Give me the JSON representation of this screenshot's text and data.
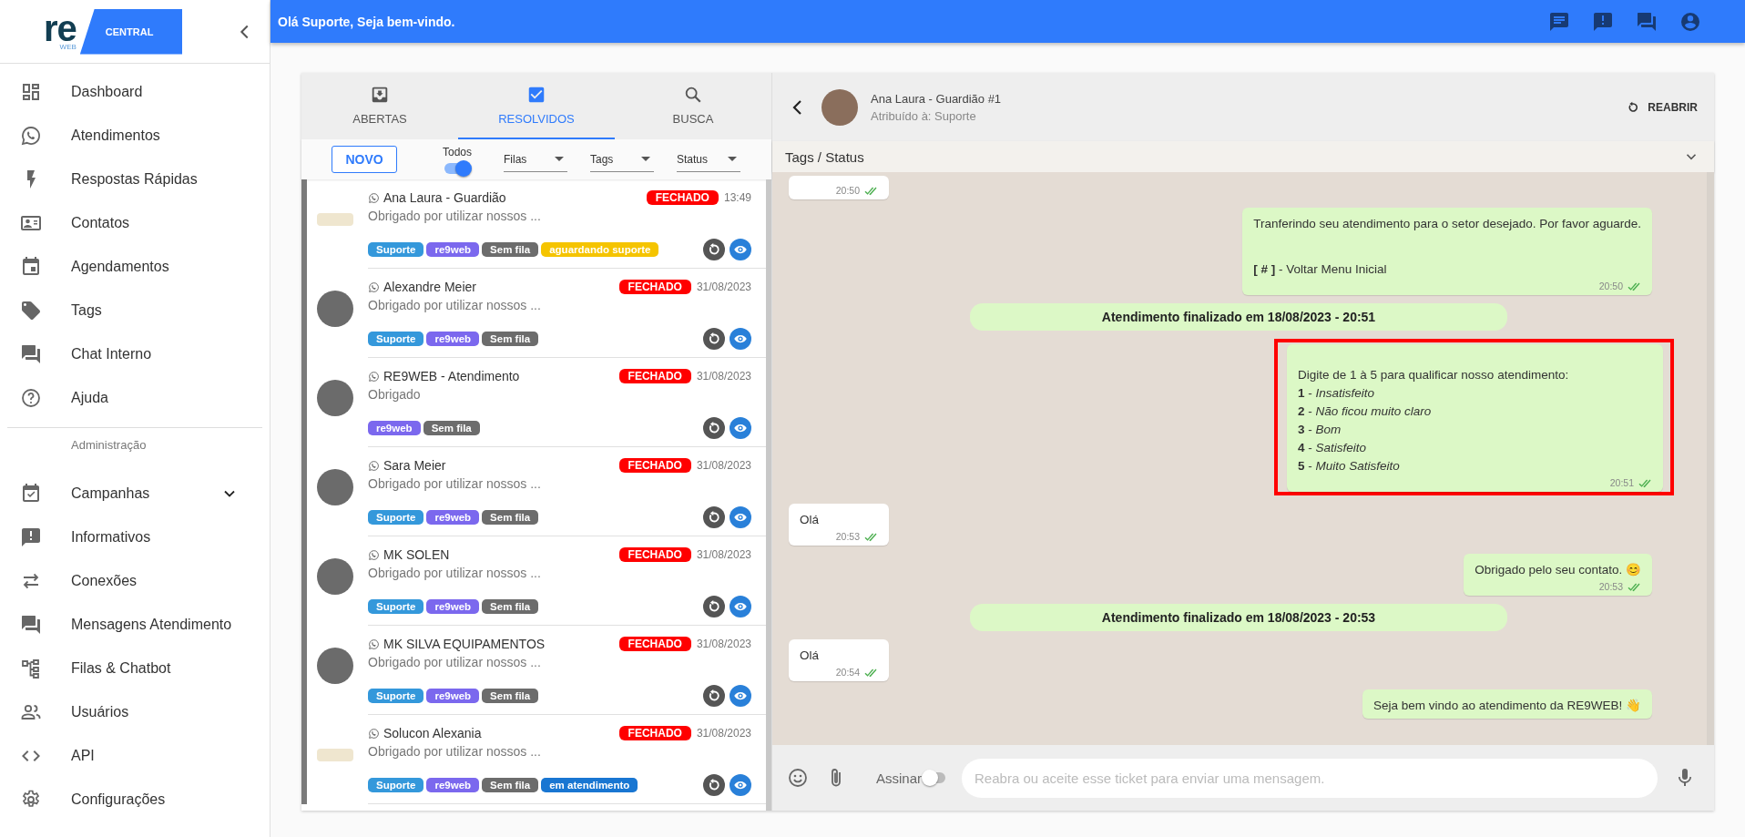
{
  "sidebar": {
    "logo": {
      "mark": "re",
      "sub": "WEB",
      "brand": "CENTRAL"
    },
    "items": [
      {
        "kind": "item",
        "label": "Dashboard"
      },
      {
        "kind": "item",
        "label": "Atendimentos"
      },
      {
        "kind": "item",
        "label": "Respostas Rápidas"
      },
      {
        "kind": "item",
        "label": "Contatos"
      },
      {
        "kind": "item",
        "label": "Agendamentos"
      },
      {
        "kind": "item",
        "label": "Tags"
      },
      {
        "kind": "item",
        "label": "Chat Interno"
      },
      {
        "kind": "item",
        "label": "Ajuda"
      },
      {
        "kind": "divider"
      },
      {
        "kind": "header",
        "label": "Administração"
      },
      {
        "kind": "item",
        "label": "Campanhas",
        "expanded": false
      },
      {
        "kind": "item",
        "label": "Informativos"
      },
      {
        "kind": "item",
        "label": "Conexões"
      },
      {
        "kind": "item",
        "label": "Mensagens Atendimento"
      },
      {
        "kind": "item",
        "label": "Filas & Chatbot"
      },
      {
        "kind": "item",
        "label": "Usuários"
      },
      {
        "kind": "item",
        "label": "API"
      },
      {
        "kind": "item",
        "label": "Configurações"
      }
    ]
  },
  "topbar": {
    "greeting": "Olá Suporte, Seja bem-vindo."
  },
  "tickets_panel": {
    "tabs": [
      {
        "label": "ABERTAS",
        "selected": false
      },
      {
        "label": "RESOLVIDOS",
        "selected": true
      },
      {
        "label": "BUSCA",
        "selected": false
      }
    ],
    "new_button": "NOVO",
    "toggle": {
      "label": "Todos",
      "on": true
    },
    "filters": [
      "Filas",
      "Tags",
      "Status"
    ],
    "tickets": [
      {
        "name": "Ana Laura - Guardião",
        "preview": "Obrigado por utilizar nossos ...",
        "status": "FECHADO",
        "time": "13:49",
        "tags": [
          {
            "label": "Suporte",
            "color": "#3498db"
          },
          {
            "label": "re9web",
            "color": "#7b68ee"
          },
          {
            "label": "Sem fila",
            "color": "#6c6c6c"
          },
          {
            "label": "aguardando suporte",
            "color": "#f5c400"
          }
        ]
      },
      {
        "name": "Alexandre Meier",
        "preview": "Obrigado por utilizar nossos ...",
        "status": "FECHADO",
        "time": "31/08/2023",
        "tags": [
          {
            "label": "Suporte",
            "color": "#3498db"
          },
          {
            "label": "re9web",
            "color": "#7b68ee"
          },
          {
            "label": "Sem fila",
            "color": "#6c6c6c"
          }
        ]
      },
      {
        "name": "RE9WEB - Atendimento",
        "preview": "Obrigado",
        "status": "FECHADO",
        "time": "31/08/2023",
        "tags": [
          {
            "label": "re9web",
            "color": "#7b68ee"
          },
          {
            "label": "Sem fila",
            "color": "#6c6c6c"
          }
        ]
      },
      {
        "name": "Sara Meier",
        "preview": "Obrigado por utilizar nossos ...",
        "status": "FECHADO",
        "time": "31/08/2023",
        "tags": [
          {
            "label": "Suporte",
            "color": "#3498db"
          },
          {
            "label": "re9web",
            "color": "#7b68ee"
          },
          {
            "label": "Sem fila",
            "color": "#6c6c6c"
          }
        ]
      },
      {
        "name": "MK SOLEN",
        "preview": "Obrigado por utilizar nossos ...",
        "status": "FECHADO",
        "time": "31/08/2023",
        "tags": [
          {
            "label": "Suporte",
            "color": "#3498db"
          },
          {
            "label": "re9web",
            "color": "#7b68ee"
          },
          {
            "label": "Sem fila",
            "color": "#6c6c6c"
          }
        ]
      },
      {
        "name": "MK SILVA EQUIPAMENTOS",
        "preview": "Obrigado por utilizar nossos ...",
        "status": "FECHADO",
        "time": "31/08/2023",
        "tags": [
          {
            "label": "Suporte",
            "color": "#3498db"
          },
          {
            "label": "re9web",
            "color": "#7b68ee"
          },
          {
            "label": "Sem fila",
            "color": "#6c6c6c"
          }
        ]
      },
      {
        "name": "Solucon Alexania",
        "preview": "Obrigado por utilizar nossos ...",
        "status": "FECHADO",
        "time": "31/08/2023",
        "tags": [
          {
            "label": "Suporte",
            "color": "#3498db"
          },
          {
            "label": "re9web",
            "color": "#7b68ee"
          },
          {
            "label": "Sem fila",
            "color": "#6c6c6c"
          },
          {
            "label": "em atendimento",
            "color": "#1976d2"
          }
        ]
      }
    ]
  },
  "chat": {
    "contact": "Ana Laura - Guardião #1",
    "assigned": "Atribuído à: Suporte",
    "reopen": "REABRIR",
    "tags_status": "Tags / Status",
    "messages": [
      {
        "kind": "in",
        "time": "20:50",
        "read": true
      },
      {
        "kind": "out",
        "blocks": [
          [
            "Tranferindo seu atendimento para o setor desejado. Por favor aguarde."
          ],
          [
            "**[ # ]** - Voltar Menu Inicial"
          ]
        ],
        "time": "20:50",
        "read": true
      },
      {
        "kind": "system",
        "text": "Atendimento finalizado em 18/08/2023 - 20:51"
      },
      {
        "kind": "out",
        "highlighted": true,
        "blocks": [
          [
            "Digite de 1 à 5 para qualificar nosso atendimento:",
            "**1** - *Insatisfeito*",
            "**2** - *Não ficou muito claro*",
            "**3** - *Bom*",
            "**4** - *Satisfeito*",
            "**5** - *Muito Satisfeito*"
          ]
        ],
        "time": "20:51",
        "read": true
      },
      {
        "kind": "in",
        "blocks": [
          [
            "Olá"
          ]
        ],
        "time": "20:53",
        "read": true
      },
      {
        "kind": "out",
        "blocks": [
          [
            "Obrigado pelo seu contato. 😊"
          ]
        ],
        "time": "20:53",
        "read": true
      },
      {
        "kind": "system",
        "text": "Atendimento finalizado em 18/08/2023 - 20:53"
      },
      {
        "kind": "in",
        "blocks": [
          [
            "Olá"
          ]
        ],
        "time": "20:54",
        "read": true
      },
      {
        "kind": "out",
        "blocks": [
          [
            "Seja bem vindo ao atendimento da RE9WEB! 👋"
          ]
        ]
      }
    ],
    "composer": {
      "sign_label": "Assinar",
      "sign_on": false,
      "placeholder": "Reabra ou aceite esse ticket para enviar uma mensagem."
    }
  }
}
